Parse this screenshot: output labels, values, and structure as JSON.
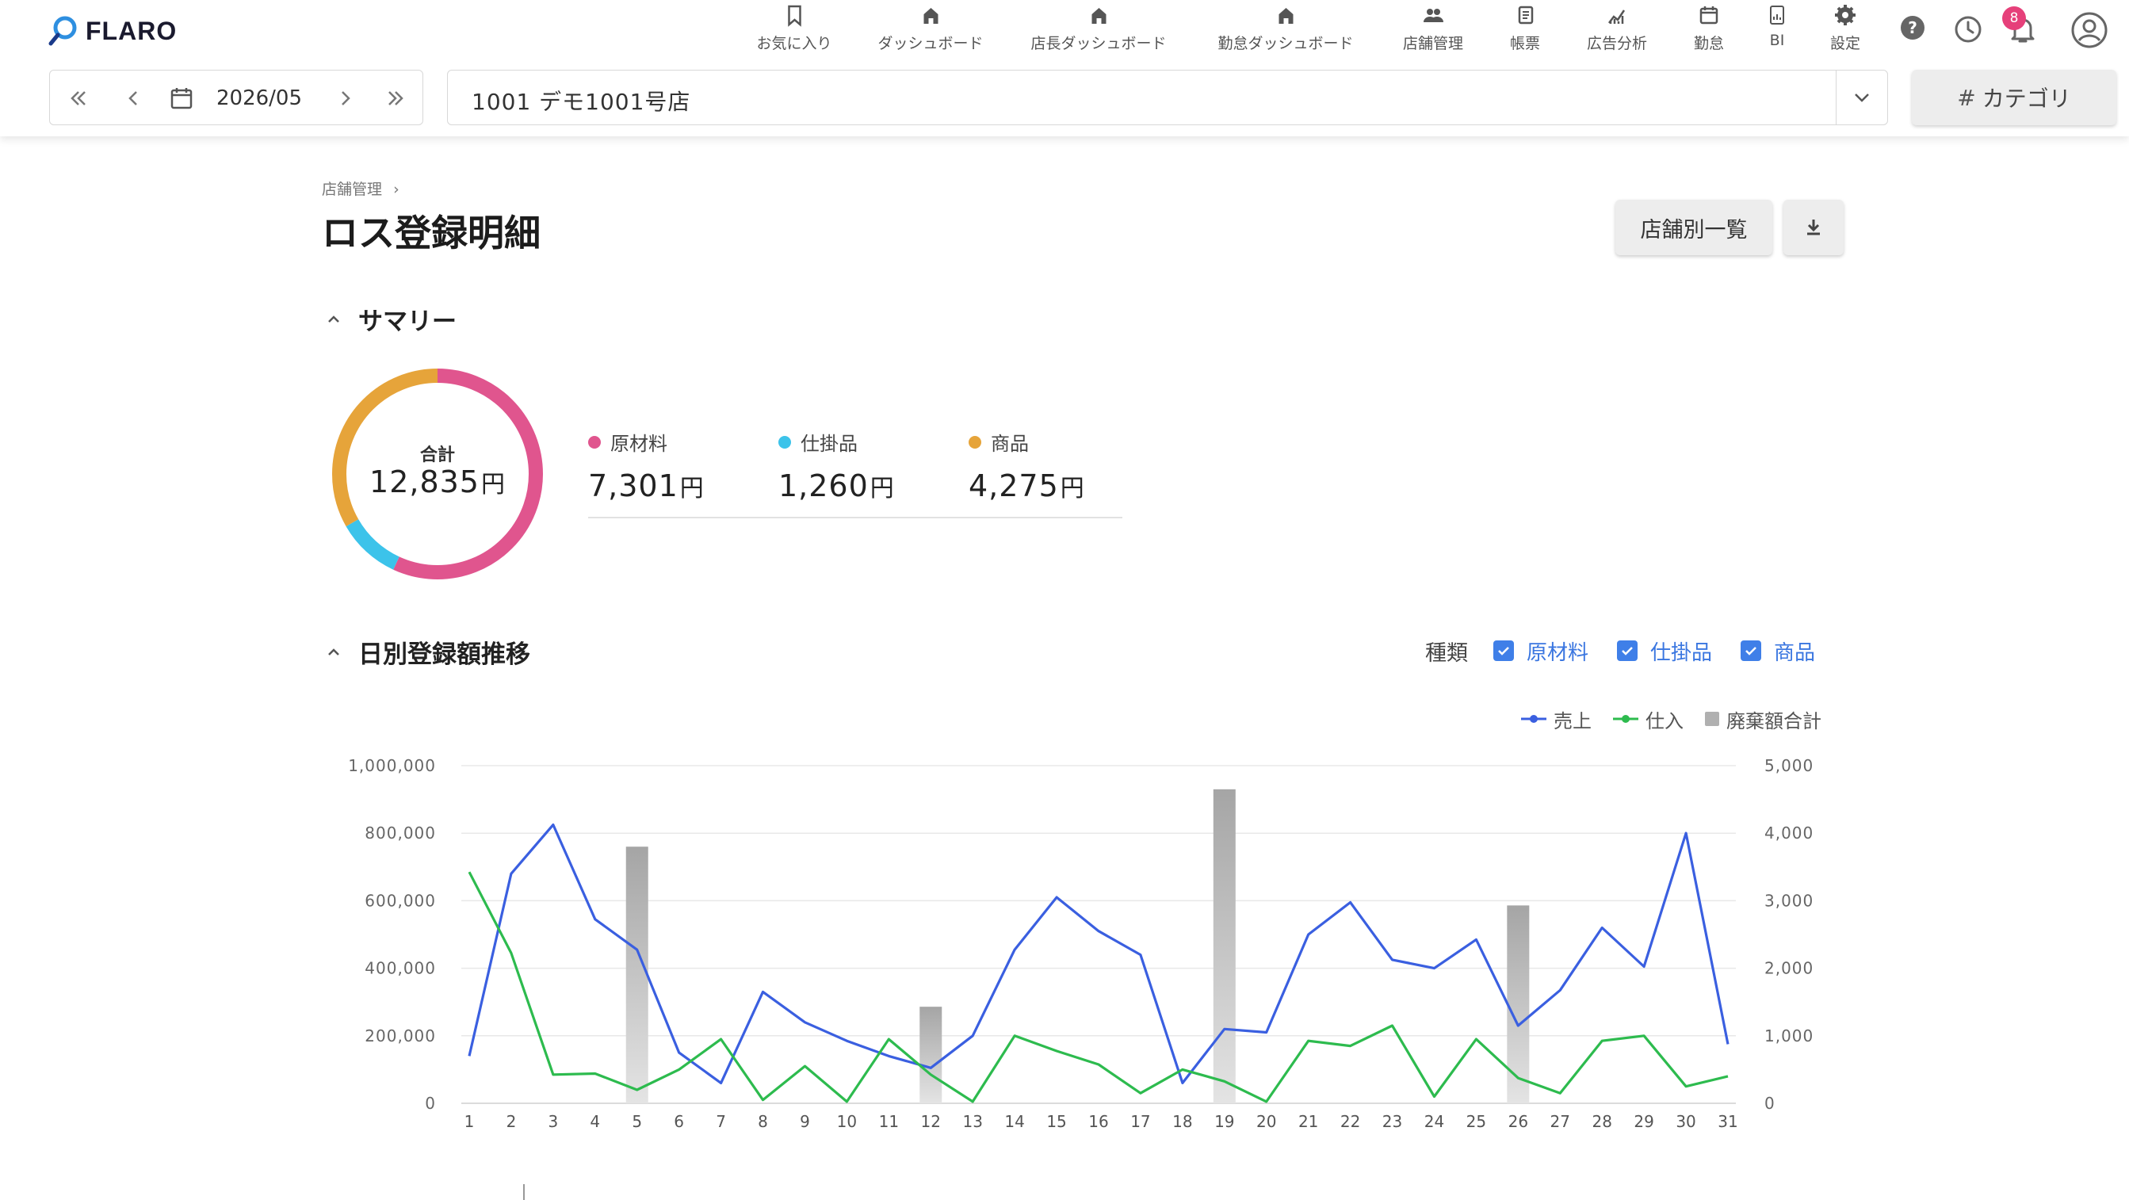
{
  "app": {
    "brand": "FLARO",
    "nav": [
      {
        "label": "お気に入り",
        "icon": "bookmark-icon"
      },
      {
        "label": "ダッシュボード",
        "icon": "home-icon"
      },
      {
        "label": "店長ダッシュボード",
        "icon": "home-icon"
      },
      {
        "label": "勤怠ダッシュボード",
        "icon": "home-icon"
      },
      {
        "label": "店舗管理",
        "icon": "people-icon"
      },
      {
        "label": "帳票",
        "icon": "report-icon"
      },
      {
        "label": "広告分析",
        "icon": "analytics-icon"
      },
      {
        "label": "勤怠",
        "icon": "calendar-icon"
      },
      {
        "label": "BI",
        "icon": "bi-icon"
      },
      {
        "label": "設定",
        "icon": "gear-icon"
      }
    ],
    "notification_count": "8",
    "date": "2026/05",
    "store": "1001 デモ1001号店",
    "category_button": "カテゴリ",
    "category_hash": "#"
  },
  "page": {
    "breadcrumb": "店舗管理",
    "breadcrumb_sep": "›",
    "title": "ロス登録明細",
    "list_button": "店舗別一覧"
  },
  "summary": {
    "title": "サマリー",
    "total_label": "合計",
    "total_value": "12,835",
    "unit": "円",
    "items": [
      {
        "label": "原材料",
        "value": "7,301",
        "amount": 7301,
        "color": "#e0558e"
      },
      {
        "label": "仕掛品",
        "value": "1,260",
        "amount": 1260,
        "color": "#3cc3ea"
      },
      {
        "label": "商品",
        "value": "4,275",
        "amount": 4275,
        "color": "#e6a43a"
      }
    ]
  },
  "daily": {
    "title": "日別登録額推移",
    "filter_title": "種類",
    "filters": [
      "原材料",
      "仕掛品",
      "商品"
    ],
    "legend": [
      {
        "name": "売上",
        "color": "#3a5fe0",
        "kind": "line"
      },
      {
        "name": "仕入",
        "color": "#2dbb4e",
        "kind": "line"
      },
      {
        "name": "廃棄額合計",
        "color": "#b0b0b0",
        "kind": "bar"
      }
    ]
  },
  "chart_data": {
    "type": "line",
    "x": [
      1,
      2,
      3,
      4,
      5,
      6,
      7,
      8,
      9,
      10,
      11,
      12,
      13,
      14,
      15,
      16,
      17,
      18,
      19,
      20,
      21,
      22,
      23,
      24,
      25,
      26,
      27,
      28,
      29,
      30,
      31
    ],
    "y_left_ticks": [
      "0",
      "200,000",
      "400,000",
      "600,000",
      "800,000",
      "1,000,000"
    ],
    "y_right_ticks": [
      "0",
      "1,000",
      "2,000",
      "3,000",
      "4,000",
      "5,000"
    ],
    "ylim_left": [
      0,
      1000000
    ],
    "ylim_right": [
      0,
      5000
    ],
    "grid": true,
    "legend_position": "top-right",
    "series": [
      {
        "name": "売上",
        "axis": "left",
        "color": "#3a5fe0",
        "values": [
          140000,
          680000,
          825000,
          545000,
          455000,
          150000,
          60000,
          330000,
          240000,
          185000,
          140000,
          105000,
          200000,
          455000,
          610000,
          510000,
          440000,
          60000,
          220000,
          210000,
          500000,
          595000,
          425000,
          400000,
          485000,
          230000,
          335000,
          520000,
          405000,
          800000,
          175000
        ]
      },
      {
        "name": "仕入",
        "axis": "left",
        "color": "#2dbb4e",
        "values": [
          685000,
          445000,
          85000,
          88000,
          40000,
          100000,
          190000,
          10000,
          110000,
          5000,
          190000,
          85000,
          5000,
          200000,
          155000,
          115000,
          30000,
          100000,
          65000,
          5000,
          185000,
          170000,
          230000,
          20000,
          190000,
          75000,
          30000,
          185000,
          200000,
          50000,
          80000
        ]
      },
      {
        "name": "廃棄額合計",
        "axis": "right",
        "type": "bar",
        "color": "#b0b0b0",
        "values": [
          0,
          0,
          0,
          0,
          3800,
          0,
          0,
          0,
          0,
          0,
          0,
          1430,
          0,
          0,
          0,
          0,
          0,
          0,
          4650,
          0,
          0,
          0,
          0,
          0,
          0,
          2930,
          0,
          0,
          0,
          0,
          0
        ]
      }
    ]
  }
}
